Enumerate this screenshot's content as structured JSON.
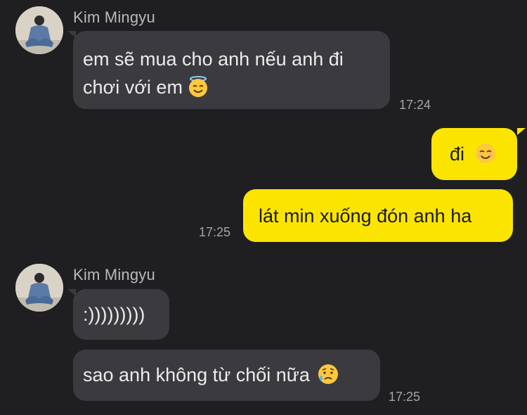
{
  "messages": {
    "group1": {
      "sender": "Kim Mingyu",
      "line1": "em sẽ mua cho anh nếu anh đi",
      "line2": "chơi với em",
      "time": "17:24"
    },
    "out1": {
      "text": "đi"
    },
    "out2": {
      "text": "lát min xuống đón anh ha",
      "time": "17:25"
    },
    "group2": {
      "sender": "Kim Mingyu",
      "msg1": ":)))))))))",
      "msg2": "sao anh không từ chối nữa",
      "time": "17:25"
    }
  },
  "icons": {
    "angel": "smiling-face-with-halo-icon",
    "smile": "smiling-face-icon",
    "sad": "sad-but-relieved-face-icon"
  },
  "colors": {
    "background": "#1f1f21",
    "incoming_bubble": "#3b3b3f",
    "outgoing_bubble": "#fbe500"
  }
}
